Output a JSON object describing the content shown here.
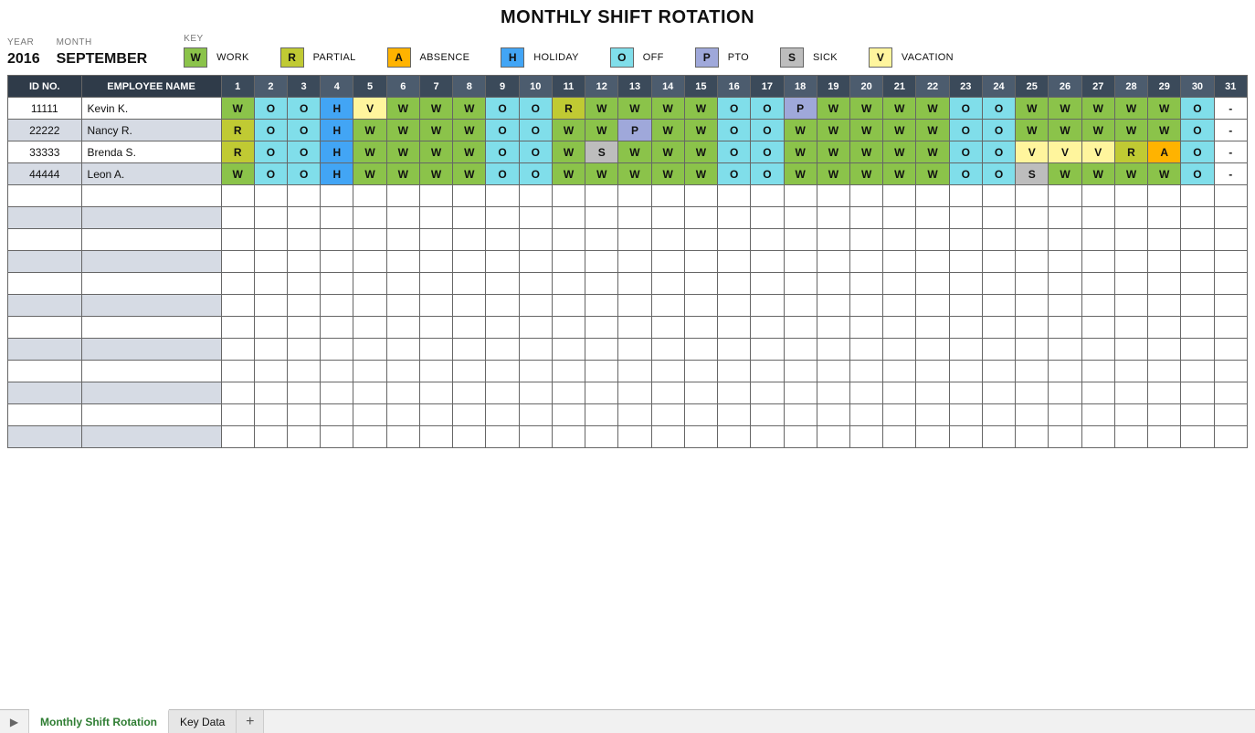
{
  "title": "MONTHLY SHIFT ROTATION",
  "header": {
    "year_label": "YEAR",
    "year": "2016",
    "month_label": "MONTH",
    "month": "SEPTEMBER",
    "key_label": "KEY"
  },
  "key": [
    {
      "code": "W",
      "label": "WORK",
      "class": "c-W"
    },
    {
      "code": "R",
      "label": "PARTIAL",
      "class": "c-R"
    },
    {
      "code": "A",
      "label": "ABSENCE",
      "class": "c-A"
    },
    {
      "code": "H",
      "label": "HOLIDAY",
      "class": "c-H"
    },
    {
      "code": "O",
      "label": "OFF",
      "class": "c-O"
    },
    {
      "code": "P",
      "label": "PTO",
      "class": "c-P"
    },
    {
      "code": "S",
      "label": "SICK",
      "class": "c-S"
    },
    {
      "code": "V",
      "label": "VACATION",
      "class": "c-V"
    }
  ],
  "columns": {
    "id": "ID NO.",
    "name": "EMPLOYEE NAME"
  },
  "days": [
    "1",
    "2",
    "3",
    "4",
    "5",
    "6",
    "7",
    "8",
    "9",
    "10",
    "11",
    "12",
    "13",
    "14",
    "15",
    "16",
    "17",
    "18",
    "19",
    "20",
    "21",
    "22",
    "23",
    "24",
    "25",
    "26",
    "27",
    "28",
    "29",
    "30",
    "31"
  ],
  "alt_days": [
    "2",
    "4",
    "6",
    "8",
    "10",
    "12",
    "14",
    "16",
    "18",
    "20",
    "22",
    "24",
    "26",
    "28",
    "30"
  ],
  "employees": [
    {
      "id": "11111",
      "name": "Kevin K.",
      "shifts": [
        "W",
        "O",
        "O",
        "H",
        "V",
        "W",
        "W",
        "W",
        "O",
        "O",
        "R",
        "W",
        "W",
        "W",
        "W",
        "O",
        "O",
        "P",
        "W",
        "W",
        "W",
        "W",
        "O",
        "O",
        "W",
        "W",
        "W",
        "W",
        "W",
        "O",
        "-"
      ]
    },
    {
      "id": "22222",
      "name": "Nancy R.",
      "shifts": [
        "R",
        "O",
        "O",
        "H",
        "W",
        "W",
        "W",
        "W",
        "O",
        "O",
        "W",
        "W",
        "P",
        "W",
        "W",
        "O",
        "O",
        "W",
        "W",
        "W",
        "W",
        "W",
        "O",
        "O",
        "W",
        "W",
        "W",
        "W",
        "W",
        "O",
        "-"
      ]
    },
    {
      "id": "33333",
      "name": "Brenda S.",
      "shifts": [
        "R",
        "O",
        "O",
        "H",
        "W",
        "W",
        "W",
        "W",
        "O",
        "O",
        "W",
        "S",
        "W",
        "W",
        "W",
        "O",
        "O",
        "W",
        "W",
        "W",
        "W",
        "W",
        "O",
        "O",
        "V",
        "V",
        "V",
        "R",
        "A",
        "O",
        "-"
      ]
    },
    {
      "id": "44444",
      "name": "Leon A.",
      "shifts": [
        "W",
        "O",
        "O",
        "H",
        "W",
        "W",
        "W",
        "W",
        "O",
        "O",
        "W",
        "W",
        "W",
        "W",
        "W",
        "O",
        "O",
        "W",
        "W",
        "W",
        "W",
        "W",
        "O",
        "O",
        "S",
        "W",
        "W",
        "W",
        "W",
        "O",
        "-"
      ]
    }
  ],
  "empty_rows": 12,
  "tabs": {
    "active": "Monthly Shift Rotation",
    "other": "Key Data",
    "add": "+"
  }
}
